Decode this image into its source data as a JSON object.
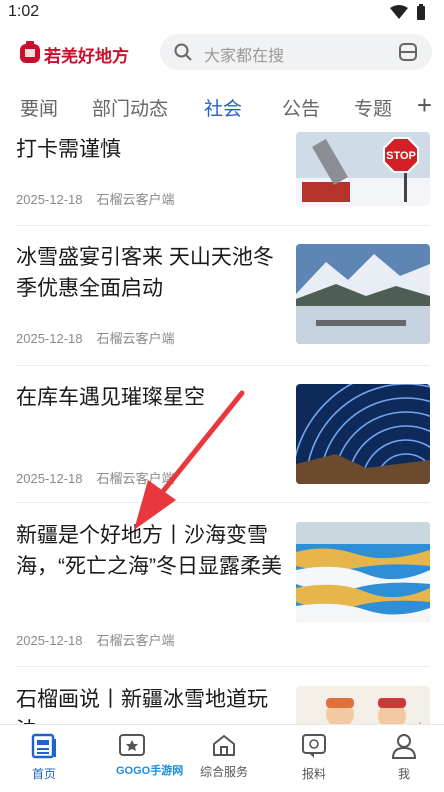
{
  "status_bar": {
    "time": "1:02"
  },
  "header": {
    "app_name": "若羌好地方",
    "search_placeholder": "大家都在搜"
  },
  "tabs": [
    {
      "label": "要闻"
    },
    {
      "label": "部门动态"
    },
    {
      "label": "社会",
      "active": true
    },
    {
      "label": "公告"
    },
    {
      "label": "专题"
    }
  ],
  "tab_add": "+",
  "feed": [
    {
      "title": "打卡需谨慎",
      "date": "2025-12-18",
      "source": "石榴云客户端",
      "thumb_text": "STOP"
    },
    {
      "title": "冰雪盛宴引客来 天山天池冬季优惠全面启动",
      "date": "2025-12-18",
      "source": "石榴云客户端"
    },
    {
      "title": "在库车遇见璀璨星空",
      "date": "2025-12-18",
      "source": "石榴云客户端"
    },
    {
      "title": "新疆是个好地方丨沙海变雪海，“死亡之海”冬日显露柔美",
      "date": "2025-12-18",
      "source": "石榴云客户端"
    },
    {
      "title": "石榴画说丨新疆冰雪地道玩法",
      "date": "",
      "source": ""
    }
  ],
  "bottom_nav": [
    {
      "label": "首页",
      "icon": "home-doc-icon",
      "active": true
    },
    {
      "label": "",
      "icon": "video-card-icon"
    },
    {
      "label": "综合服务",
      "icon": "house-icon"
    },
    {
      "label": "报料",
      "icon": "chat-at-icon"
    },
    {
      "label": "我",
      "icon": "user-icon"
    }
  ],
  "watermark": "GOGO手游网",
  "colors": {
    "brand_red": "#c8102e",
    "accent_blue": "#1e63c9",
    "arrow_red": "#e8383d"
  }
}
